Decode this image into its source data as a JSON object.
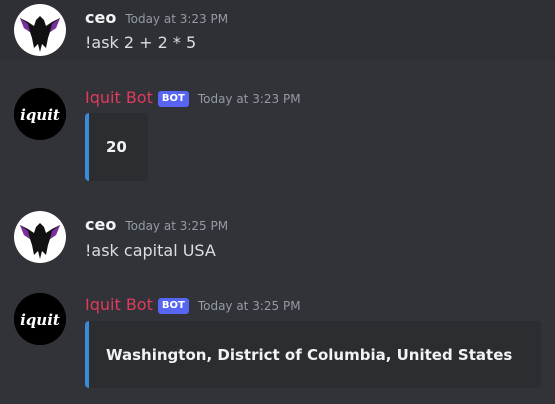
{
  "messages": [
    {
      "username": "ceo",
      "timestamp": "Today at 3:23 PM",
      "text": "!ask 2 + 2 * 5"
    },
    {
      "username": "Iquit Bot",
      "badge": "BOT",
      "timestamp": "Today at 3:23 PM",
      "embed_text": "20",
      "avatar_text": "iquit"
    },
    {
      "username": "ceo",
      "timestamp": "Today at 3:25 PM",
      "text": "!ask capital USA"
    },
    {
      "username": "Iquit Bot",
      "badge": "BOT",
      "timestamp": "Today at 3:25 PM",
      "embed_text": "Washington, District of Columbia, United States",
      "avatar_text": "iquit"
    }
  ],
  "colors": {
    "background": "#313338",
    "bot_name": "#e03a5c",
    "bot_badge": "#5865f2",
    "embed_accent": "#3b8bd6",
    "embed_bg": "#2b2d31"
  }
}
